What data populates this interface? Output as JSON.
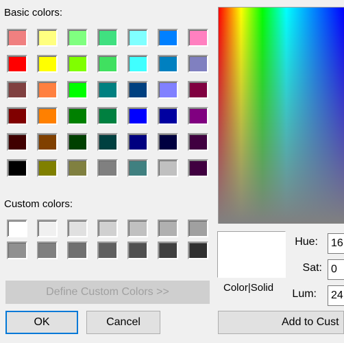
{
  "labels": {
    "basic": "Basic colors:",
    "custom": "Custom colors:",
    "color_solid": "Color|Solid",
    "hue": "Hue:",
    "sat": "Sat:",
    "lum": "Lum:"
  },
  "buttons": {
    "define_custom": "Define Custom Colors >>",
    "ok": "OK",
    "cancel": "Cancel",
    "add_to_custom": "Add to Cust"
  },
  "fields": {
    "hue": "16",
    "sat": "0",
    "lum": "24"
  },
  "basic_colors": [
    "#f08080",
    "#ffff80",
    "#80ff80",
    "#40e080",
    "#80ffff",
    "#0080ff",
    "#ff80c0",
    "#ff0000",
    "#ffff00",
    "#80ff00",
    "#40e060",
    "#40ffff",
    "#0080c0",
    "#8080c0",
    "#804040",
    "#ff8040",
    "#00ff00",
    "#008080",
    "#004080",
    "#8080ff",
    "#800040",
    "#800000",
    "#ff8000",
    "#008000",
    "#008040",
    "#0000ff",
    "#0000a0",
    "#800080",
    "#400000",
    "#804000",
    "#004000",
    "#004040",
    "#000080",
    "#000040",
    "#400040",
    "#000000",
    "#808000",
    "#808040",
    "#808080",
    "#408080",
    "#c0c0c0",
    "#400040"
  ],
  "custom_colors": [
    "#ffffff",
    "#f0f0f0",
    "#e0e0e0",
    "#d0d0d0",
    "#c0c0c0",
    "#b0b0b0",
    "#a0a0a0",
    "#909090",
    "#808080",
    "#707070",
    "#606060",
    "#505050",
    "#404040",
    "#303030"
  ],
  "preview_color": "#ffffff"
}
